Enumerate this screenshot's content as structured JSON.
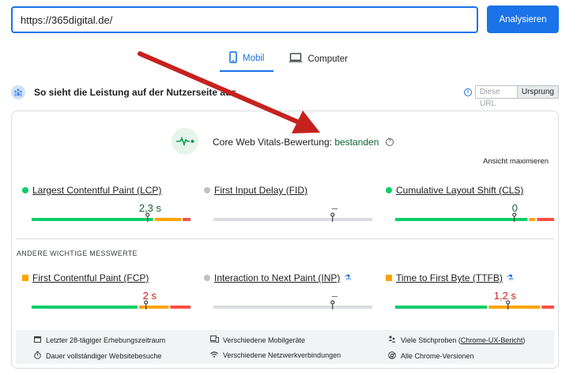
{
  "search": {
    "url_value": "https://365digital.de/",
    "analyze_label": "Analysieren"
  },
  "tabs": [
    {
      "label": "Mobil",
      "icon": "smartphone-icon",
      "active": true
    },
    {
      "label": "Computer",
      "icon": "desktop-icon",
      "active": false
    }
  ],
  "section": {
    "title": "So sieht die Leistung auf der Nutzerseite aus",
    "toggle_url": "Diese URL",
    "toggle_origin": "Ursprung",
    "info_glyph": "i"
  },
  "cwv": {
    "label": "Core Web Vitals-Bewertung:",
    "status": "bestanden",
    "help_glyph": "?",
    "expand_label": "Ansicht maximieren"
  },
  "core_metrics": [
    {
      "name": "Largest Contentful Paint (LCP)",
      "value": "2,3 s",
      "status_color": "#0cce6b",
      "value_color": "#0d652d",
      "has_bar_data": true,
      "distribution": [
        0.78,
        0.17,
        0.05
      ],
      "marker": 0.73
    },
    {
      "name": "First Input Delay (FID)",
      "value": "–",
      "status_color": "#bdc1c6",
      "value_color": "#5f6368",
      "has_bar_data": false,
      "distribution": [
        1
      ],
      "marker": 0.75
    },
    {
      "name": "Cumulative Layout Shift (CLS)",
      "value": "0",
      "status_color": "#0cce6b",
      "value_color": "#0d652d",
      "has_bar_data": true,
      "distribution": [
        0.85,
        0.04,
        0.11
      ],
      "marker": 0.75
    }
  ],
  "other_title": "ANDERE WICHTIGE MESSWERTE",
  "other_metrics": [
    {
      "name": "First Contentful Paint (FCP)",
      "value": "2 s",
      "status_color": "#ffa400",
      "value_color": "#c5221f",
      "shape": "square",
      "experimental": false,
      "has_bar_data": true,
      "distribution": [
        0.68,
        0.19,
        0.13
      ],
      "marker": 0.72
    },
    {
      "name": "Interaction to Next Paint (INP)",
      "value": "–",
      "status_color": "#bdc1c6",
      "value_color": "#5f6368",
      "shape": "dot",
      "experimental": true,
      "has_bar_data": false,
      "distribution": [
        1
      ],
      "marker": 0.75
    },
    {
      "name": "Time to First Byte (TTFB)",
      "value": "1,2 s",
      "status_color": "#ffa400",
      "value_color": "#c5221f",
      "shape": "square",
      "experimental": true,
      "has_bar_data": true,
      "distribution": [
        0.59,
        0.33,
        0.08
      ],
      "marker": 0.71
    }
  ],
  "footer": {
    "collection_period": "Letzter 28-tägiger Erhebungszeitraum",
    "devices": "Verschiedene Mobilgeräte",
    "samples_prefix": "Viele Stichproben (",
    "samples_link": "Chrome-UX-Bericht",
    "samples_suffix": ")",
    "visits": "Dauer vollständiger Websitebesuche",
    "networks": "Verschiedene Netzwerkverbindungen",
    "versions": "Alle Chrome-Versionen"
  },
  "colors": {
    "accent": "#1a73e8",
    "good": "#0cce6b",
    "average": "#ffa400",
    "poor": "#ff4e42",
    "no_data": "#dadce0",
    "annotation_arrow": "#c5221f"
  }
}
